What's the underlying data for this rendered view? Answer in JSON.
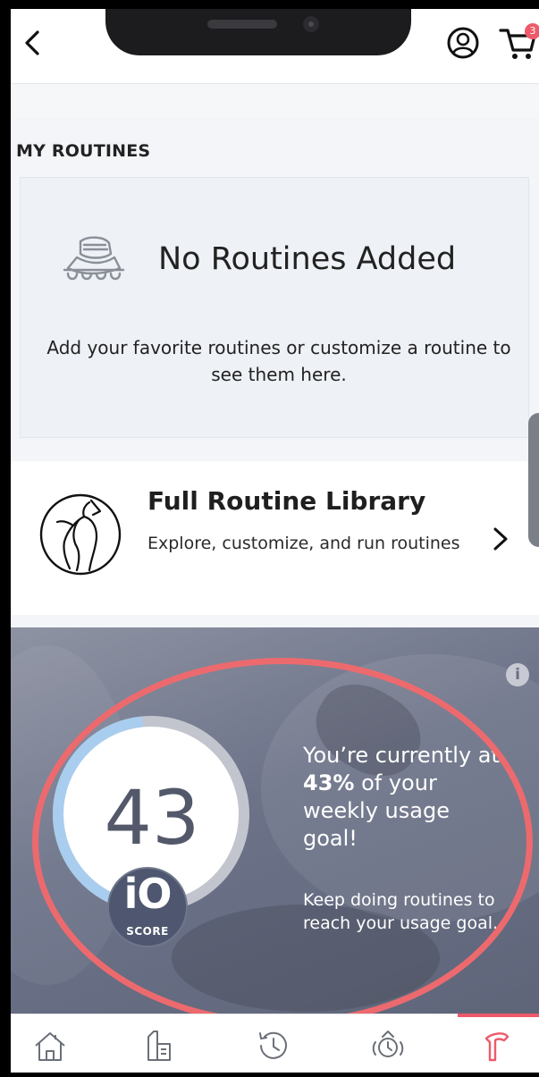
{
  "header": {
    "back_label": "back",
    "cart_count": "3"
  },
  "routines": {
    "section_title": "MY ROUTINES",
    "empty_title": "No Routines Added",
    "empty_description": "Add your favorite routines or customize a routine to see them here."
  },
  "library": {
    "title": "Full Routine Library",
    "description": "Explore, customize, and run routines"
  },
  "score": {
    "value": "43",
    "progress": 0.43,
    "badge_text": "iO",
    "badge_label": "SCORE",
    "usage_prefix": "You’re currently at ",
    "usage_percent": "43%",
    "usage_suffix": " of your weekly usage goal!",
    "keep_text": "Keep doing routines to reach your usage goal.",
    "info_label": "i"
  },
  "nav": {
    "items": [
      {
        "name": "home-icon"
      },
      {
        "name": "products-icon"
      },
      {
        "name": "history-icon"
      },
      {
        "name": "device-timer-icon"
      },
      {
        "name": "theragun-icon"
      }
    ]
  },
  "colors": {
    "accent": "#ee5a6a",
    "ring_progress": "#a9cdee",
    "ring_track": "#c2c5ce",
    "score_text": "#53586a"
  }
}
